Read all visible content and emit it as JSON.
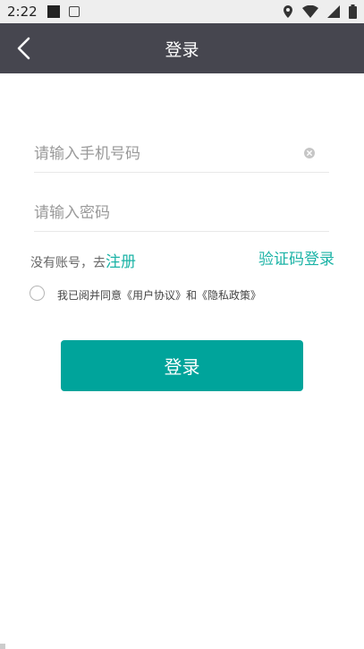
{
  "status_bar": {
    "time": "2:22",
    "icons": [
      "notification-square-icon",
      "app-a-icon",
      "location-icon",
      "wifi-icon",
      "signal-icon",
      "battery-icon"
    ]
  },
  "header": {
    "title": "登录",
    "back_icon": "chevron-left-icon"
  },
  "form": {
    "phone_placeholder": "请输入手机号码",
    "phone_value": "",
    "password_placeholder": "请输入密码",
    "password_value": "",
    "clear_icon": "clear-circle-icon"
  },
  "links": {
    "no_account_text": "没有账号，去",
    "register_label": "注册",
    "code_login_label": "验证码登录"
  },
  "agreement": {
    "prefix": "我已阅并同意",
    "user_agreement": "《用户协议》",
    "and": "和",
    "privacy_policy": "《隐私政策》",
    "checked": false
  },
  "login_button": {
    "label": "登录"
  },
  "colors": {
    "nav_bg": "#46464f",
    "accent": "#1bb3a6",
    "button_bg": "#00a49b"
  }
}
